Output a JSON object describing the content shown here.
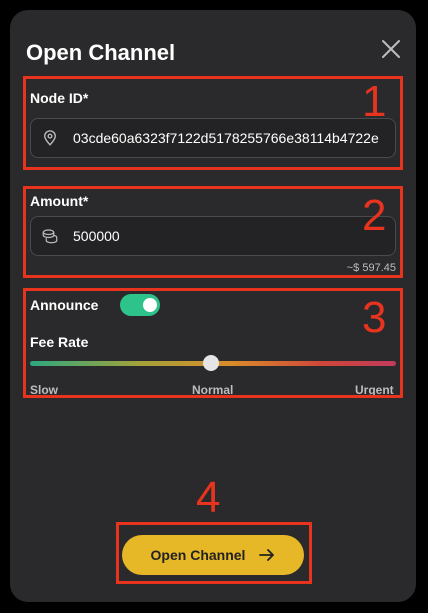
{
  "modal": {
    "title": "Open Channel",
    "close_icon": "close-icon"
  },
  "node": {
    "label": "Node ID*",
    "icon": "location-pin-icon",
    "value": "03cde60a6323f7122d5178255766e38114b4722e"
  },
  "amount": {
    "label": "Amount*",
    "icon": "coins-icon",
    "value": "500000",
    "usd_estimate": "~$ 597.45"
  },
  "announce": {
    "label": "Announce",
    "enabled": true
  },
  "fee_rate": {
    "label": "Fee Rate",
    "ticks": [
      "Slow",
      "Normal",
      "Urgent"
    ],
    "selected": "Normal"
  },
  "submit": {
    "label": "Open Channel",
    "icon": "arrow-right-icon",
    "color": "#e6b727"
  },
  "annotations": {
    "color": "#e8341e",
    "numbers": [
      "1",
      "2",
      "3",
      "4"
    ]
  }
}
